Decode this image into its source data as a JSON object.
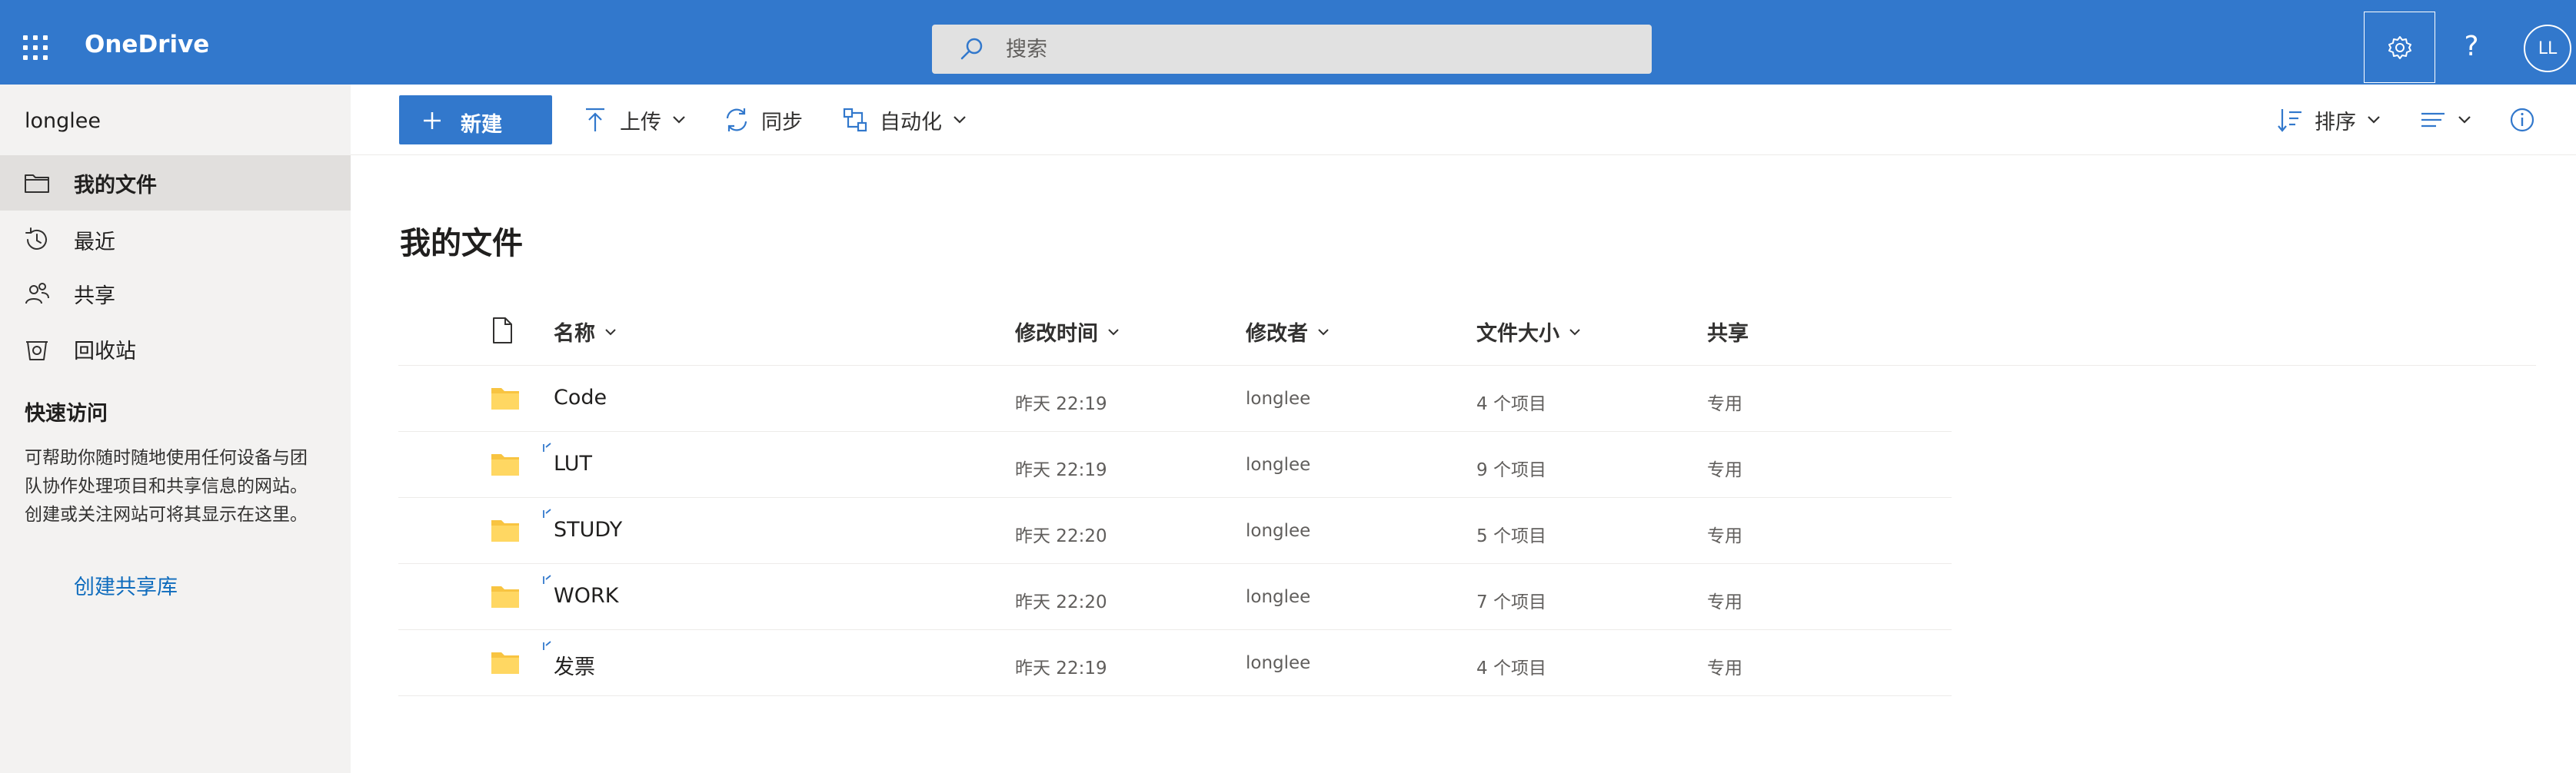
{
  "app": {
    "name": "OneDrive",
    "search_placeholder": "搜索",
    "avatar_initials": "LL",
    "help_glyph": "?"
  },
  "sidebar": {
    "username": "longlee",
    "items": [
      {
        "label": "我的文件",
        "icon": "folder-icon",
        "active": true
      },
      {
        "label": "最近",
        "icon": "history-icon",
        "active": false
      },
      {
        "label": "共享",
        "icon": "people-icon",
        "active": false
      },
      {
        "label": "回收站",
        "icon": "recycle-bin-icon",
        "active": false
      }
    ],
    "quick_access": {
      "title": "快速访问",
      "description": "可帮助你随时随地使用任何设备与团队协作处理项目和共享信息的网站。创建或关注网站可将其显示在这里。",
      "link": "创建共享库"
    }
  },
  "toolbar": {
    "new_label": "新建",
    "upload_label": "上传",
    "sync_label": "同步",
    "automate_label": "自动化",
    "sort_label": "排序"
  },
  "main": {
    "title": "我的文件",
    "columns": {
      "name": "名称",
      "modified": "修改时间",
      "modified_by": "修改者",
      "size": "文件大小",
      "sharing": "共享"
    },
    "rows": [
      {
        "name": "Code",
        "modified": "昨天 22:19",
        "modified_by": "longlee",
        "size": "4 个项目",
        "sharing": "专用",
        "new": false
      },
      {
        "name": "LUT",
        "modified": "昨天 22:19",
        "modified_by": "longlee",
        "size": "9 个项目",
        "sharing": "专用",
        "new": true
      },
      {
        "name": "STUDY",
        "modified": "昨天 22:20",
        "modified_by": "longlee",
        "size": "5 个项目",
        "sharing": "专用",
        "new": true
      },
      {
        "name": "WORK",
        "modified": "昨天 22:20",
        "modified_by": "longlee",
        "size": "7 个项目",
        "sharing": "专用",
        "new": true
      },
      {
        "name": "发票",
        "modified": "昨天 22:19",
        "modified_by": "longlee",
        "size": "4 个项目",
        "sharing": "专用",
        "new": true
      }
    ]
  },
  "colors": {
    "brand": "#3278cc",
    "link": "#0f6cbd",
    "folder": "#ffce4a",
    "sidebar_bg": "#f3f2f1"
  }
}
